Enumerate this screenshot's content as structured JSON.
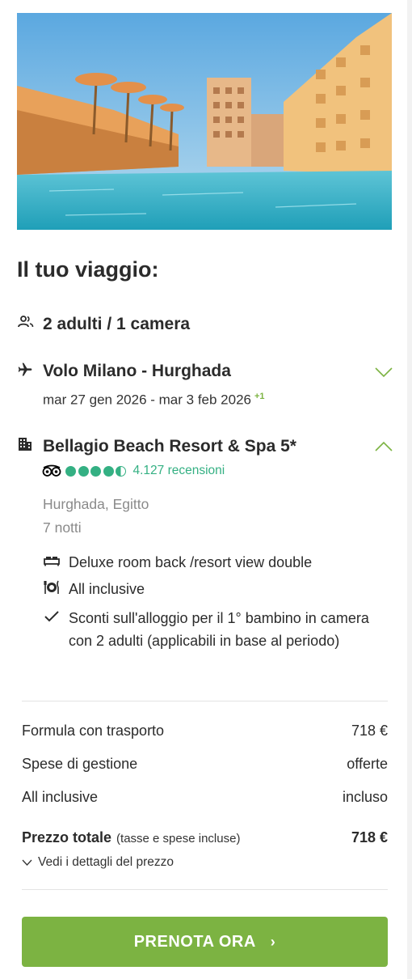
{
  "trip": {
    "title": "Il tuo viaggio:",
    "travelers": "2 adulti / 1 camera",
    "flight": {
      "title": "Volo Milano - Hurghada",
      "dates": "mar 27 gen 2026 - mar 3 feb 2026",
      "day_offset": "+1"
    },
    "hotel": {
      "name": "Bellagio Beach Resort & Spa 5*",
      "rating_dots": 4.5,
      "reviews": "4.127 recensioni",
      "location": "Hurghada, Egitto",
      "nights": "7 notti",
      "features": [
        {
          "icon": "bed-icon",
          "text": "Deluxe room back /resort view double"
        },
        {
          "icon": "meal-icon",
          "text": "All inclusive"
        },
        {
          "icon": "check-icon",
          "text": "Sconti sull'alloggio per il 1° bambino in camera con 2 adulti (applicabili in base al periodo)"
        }
      ]
    }
  },
  "pricing": {
    "rows": [
      {
        "label": "Formula con trasporto",
        "value": "718 €"
      },
      {
        "label": "Spese di gestione",
        "value": "offerte"
      },
      {
        "label": "All inclusive",
        "value": "incluso"
      }
    ],
    "total_label": "Prezzo totale",
    "total_note": "(tasse e spese incluse)",
    "total_value": "718 €",
    "details_link": "Vedi i dettagli del prezzo"
  },
  "cta": {
    "label": "PRENOTA ORA",
    "arrow": "›"
  },
  "colors": {
    "accent_green": "#7cb342",
    "tripadvisor_green": "#34b083"
  }
}
